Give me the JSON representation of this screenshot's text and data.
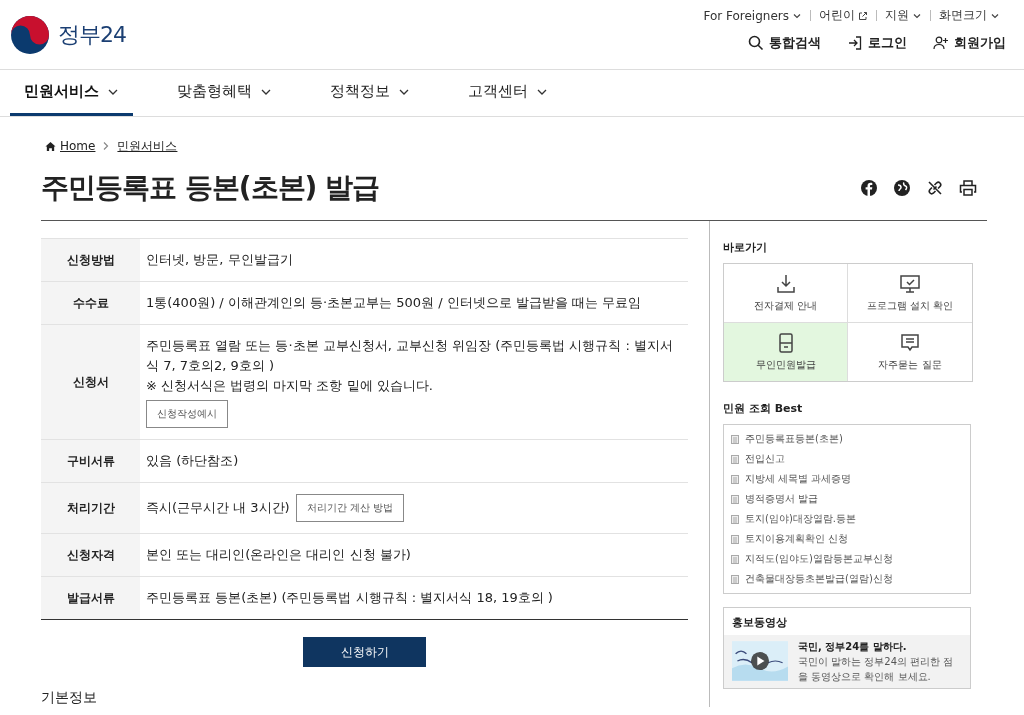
{
  "header": {
    "logo_text": "정부24",
    "utility_links": [
      {
        "label": "For Foreigners",
        "kind": "dropdown"
      },
      {
        "label": "어린이",
        "kind": "external"
      },
      {
        "label": "지원",
        "kind": "dropdown"
      },
      {
        "label": "화면크기",
        "kind": "dropdown"
      }
    ],
    "actions": [
      {
        "label": "통합검색",
        "kind": "search"
      },
      {
        "label": "로그인",
        "kind": "login"
      },
      {
        "label": "회원가입",
        "kind": "signup"
      }
    ]
  },
  "nav": [
    {
      "label": "민원서비스",
      "selected": true
    },
    {
      "label": "맞춤형혜택",
      "selected": false
    },
    {
      "label": "정책정보",
      "selected": false
    },
    {
      "label": "고객센터",
      "selected": false
    }
  ],
  "breadcrumb": [
    "Home",
    "민원서비스"
  ],
  "title": "주민등록표 등본(초본) 발급",
  "info_table": [
    {
      "label": "신청방법",
      "kind": "text",
      "lines": [
        "인터넷, 방문, 무인발급기"
      ]
    },
    {
      "label": "수수료",
      "kind": "text",
      "lines": [
        "1통(400원) / 이해관계인의 등·초본교부는 500원 / 인터넷으로 발급받을 때는 무료임"
      ]
    },
    {
      "label": "신청서",
      "kind": "button_below",
      "lines": [
        "주민등록표 열람 또는 등·초본 교부신청서, 교부신청 위임장 (주민등록법 시행규칙 : 별지서식 7, 7호의2, 9호의 )",
        "※ 신청서식은 법령의 마지막 조항 밑에 있습니다."
      ],
      "button": "신청작성예시"
    },
    {
      "label": "구비서류",
      "kind": "text",
      "lines": [
        "있음 (하단참조)"
      ]
    },
    {
      "label": "처리기간",
      "kind": "button_inline",
      "lines": [
        "즉시(근무시간 내 3시간)"
      ],
      "button": "처리기간 계산 방법"
    },
    {
      "label": "신청자격",
      "kind": "text",
      "lines": [
        "본인 또는 대리인(온라인은 대리인 신청 불가)"
      ]
    },
    {
      "label": "발급서류",
      "kind": "text",
      "lines": [
        "주민등록표 등본(초본) (주민등록법 시행규칙 : 별지서식 18, 19호의 )"
      ]
    }
  ],
  "apply_button": "신청하기",
  "section_heading": "기본정보",
  "sidebar": {
    "quick_title": "바로가기",
    "quick_links": [
      {
        "label": "전자결제 안내",
        "kind": "download",
        "selected": false
      },
      {
        "label": "프로그램 설치 확인",
        "kind": "monitor",
        "selected": false
      },
      {
        "label": "무인민원발급",
        "kind": "kiosk",
        "selected": true
      },
      {
        "label": "자주묻는 질문",
        "kind": "chat",
        "selected": false
      }
    ],
    "best_title": "민원 조회 Best",
    "best_items": [
      "주민등록표등본(초본)",
      "전입신고",
      "지방세 세목별 과세증명",
      "병적증명서 발급",
      "토지(임야)대장열람.등본",
      "토지이용계획확인 신청",
      "지적도(임야도)열람등본교부신청",
      "건축물대장등초본발급(열람)신청"
    ],
    "video": {
      "title": "홍보동영상",
      "headline": "국민, 정부24를 말하다.",
      "description": "국민이 말하는 정부24의 편리한 점을 동영상으로 확인해 보세요."
    }
  }
}
